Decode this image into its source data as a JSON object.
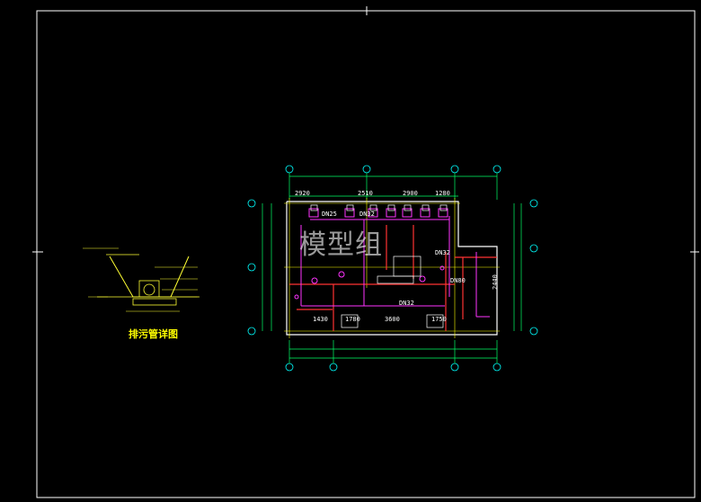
{
  "dims_top": [
    "2920",
    "2510",
    "2900",
    "1280"
  ],
  "dims_bottom": [
    "1430",
    "1780",
    "3600",
    "1750"
  ],
  "dim_right": "2440",
  "pipe_tags": [
    "DN25",
    "DN32",
    "DN32",
    "DN32",
    "DN80"
  ],
  "section_title": "排污管详图",
  "watermark": "模型组",
  "colors": {
    "frame": "#ffffff",
    "walls": "#ff3333",
    "pipes": "#ff33ff",
    "grid": "#ffff00",
    "dims": "#00ff00",
    "axis": "#00ffff"
  }
}
